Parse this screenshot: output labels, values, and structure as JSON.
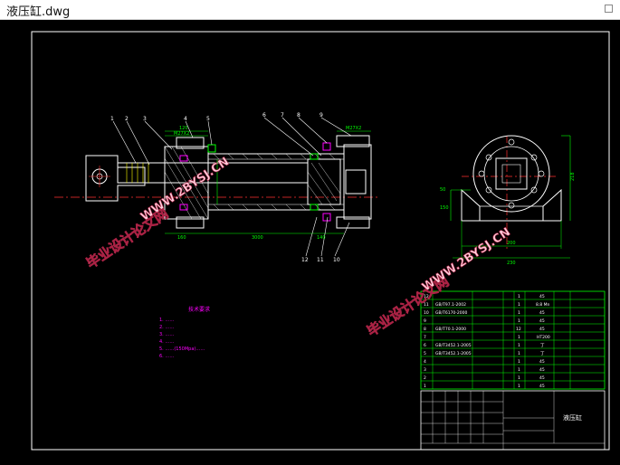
{
  "window": {
    "title": "液压缸.dwg"
  },
  "drawing": {
    "part_labels": [
      "1",
      "2",
      "3",
      "4",
      "5",
      "6",
      "7",
      "8",
      "9",
      "10",
      "11",
      "12"
    ],
    "dims": {
      "top_a": "120",
      "top_b": "M27X2",
      "right_top": "M27X2",
      "bottom_a": "160",
      "bottom_b": "3000",
      "bottom_c": "140",
      "right_view_height": "218",
      "right_view_w1": "200",
      "right_view_w2": "230",
      "left_small_a": "50",
      "left_small_b": "150"
    },
    "notes_title": "技术要求",
    "note_lines": [
      "1. ……",
      "2. ……",
      "3. ……",
      "4. ……",
      "5. ……(150Mpa)……",
      "6. ……"
    ],
    "watermarks": {
      "cn": "毕业设计论文网",
      "url": "WWW.2BYSJ.CN"
    }
  },
  "bom": {
    "rows": [
      {
        "no": "12",
        "code": "",
        "name": "",
        "qty": "1",
        "material": "45"
      },
      {
        "no": "11",
        "code": "GB/T97.1-2002",
        "name": "",
        "qty": "1",
        "material": "8.8 Mn"
      },
      {
        "no": "10",
        "code": "GB/T6170-2000",
        "name": "",
        "qty": "1",
        "material": "45"
      },
      {
        "no": "9",
        "code": "",
        "name": "",
        "qty": "1",
        "material": "45"
      },
      {
        "no": "8",
        "code": "GB/T70.1-2000",
        "name": "",
        "qty": "12",
        "material": "45"
      },
      {
        "no": "7",
        "code": "",
        "name": "",
        "qty": "1",
        "material": "HT200"
      },
      {
        "no": "6",
        "code": "GB/T3452.1-2005",
        "name": "",
        "qty": "1",
        "material": "丁"
      },
      {
        "no": "5",
        "code": "GB/T3452.1-2005",
        "name": "",
        "qty": "1",
        "material": "丁"
      },
      {
        "no": "4",
        "code": "",
        "name": "",
        "qty": "1",
        "material": "45"
      },
      {
        "no": "3",
        "code": "",
        "name": "",
        "qty": "1",
        "material": "45"
      },
      {
        "no": "2",
        "code": "",
        "name": "",
        "qty": "1",
        "material": "45"
      },
      {
        "no": "1",
        "code": "",
        "name": "",
        "qty": "1",
        "material": "45"
      }
    ],
    "title_block": {
      "name": "液压缸"
    }
  }
}
